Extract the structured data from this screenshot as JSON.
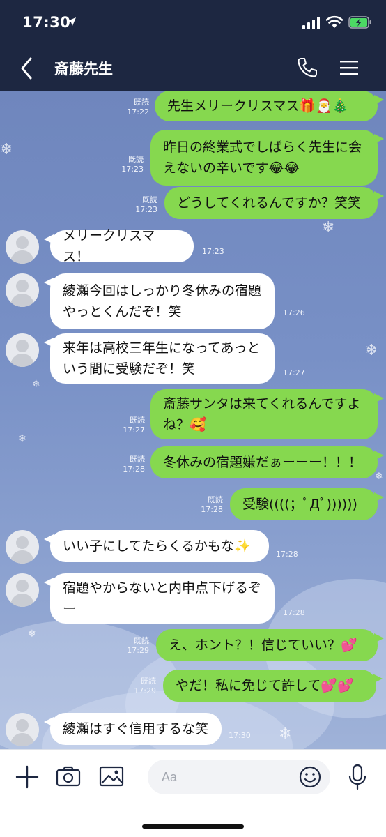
{
  "status_bar": {
    "time": "17:30"
  },
  "header": {
    "title": "斎藤先生"
  },
  "messages": [
    {
      "dir": "out",
      "text": "先生メリークリスマス🎁🎅🎄",
      "read": "既読",
      "time": "17:22"
    },
    {
      "dir": "out",
      "text": "昨日の終業式でしばらく先生に会えないの辛いです😂😂",
      "read": "既読",
      "time": "17:23"
    },
    {
      "dir": "out",
      "text": "どうしてくれるんですか？笑笑",
      "read": "既読",
      "time": "17:23"
    },
    {
      "dir": "in",
      "text": "メリークリスマス！",
      "time": "17:23"
    },
    {
      "dir": "in",
      "text": "綾瀬今回はしっかり冬休みの宿題やっとくんだぞ！笑",
      "time": "17:26"
    },
    {
      "dir": "in",
      "text": "来年は高校三年生になってあっという間に受験だぞ！笑",
      "time": "17:27"
    },
    {
      "dir": "out",
      "text": "斎藤サンタは来てくれるんですよね？🥰",
      "read": "既読",
      "time": "17:27"
    },
    {
      "dir": "out",
      "text": "冬休みの宿題嫌だぁーーー！！！",
      "read": "既読",
      "time": "17:28"
    },
    {
      "dir": "out",
      "text": "受験((((；ﾟДﾟ))))))",
      "read": "既読",
      "time": "17:28"
    },
    {
      "dir": "in",
      "text": "いい子にしてたらくるかもな✨",
      "time": "17:28"
    },
    {
      "dir": "in",
      "text": "宿題やからないと内申点下げるぞー",
      "time": "17:28"
    },
    {
      "dir": "out",
      "text": "え、ホント？！信じていい？💕",
      "read": "既読",
      "time": "17:29"
    },
    {
      "dir": "out",
      "text": "やだ！私に免じて許して💕💕",
      "read": "既読",
      "time": "17:29"
    },
    {
      "dir": "in",
      "text": "綾瀬はすぐ信用するな笑",
      "time": "17:30"
    }
  ],
  "composer": {
    "placeholder": "Aa"
  },
  "colors": {
    "header_bg": "#1d2741",
    "outgoing_bubble": "#86d84f",
    "incoming_bubble": "#ffffff",
    "chat_bg": "#7f95c4"
  },
  "icons": [
    "back-icon",
    "phone-icon",
    "menu-icon",
    "plus-icon",
    "camera-icon",
    "image-icon",
    "emoji-icon",
    "microphone-icon"
  ]
}
